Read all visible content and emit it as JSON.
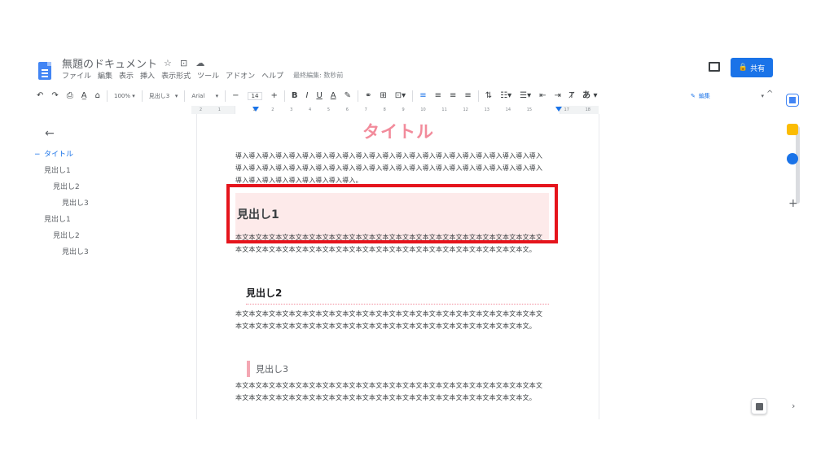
{
  "header": {
    "doc_title": "無題のドキュメント",
    "title_icons": [
      "☆",
      "⊡",
      "☁"
    ],
    "menus": [
      "ファイル",
      "編集",
      "表示",
      "挿入",
      "表示形式",
      "ツール",
      "アドオン",
      "ヘルプ"
    ],
    "last_edit": "最終編集: 数秒前",
    "share_label": "共有",
    "share_icon": "lock-icon"
  },
  "toolbar": {
    "undo": "↶",
    "redo": "↷",
    "print": "⎙",
    "spell": "A̲",
    "paint": "⌂",
    "zoom": "100%",
    "zoom_caret": "▾",
    "style": "見出し3",
    "style_caret": "▾",
    "font": "Arial",
    "font_caret": "▾",
    "minus": "−",
    "font_size": "14",
    "plus": "+",
    "bold": "B",
    "italic": "I",
    "underline": "U",
    "text_color": "A",
    "highlight": "✎",
    "link": "⚭",
    "comment": "⊞",
    "image": "⊡▾",
    "align_left": "≡",
    "align_center": "≡",
    "align_right": "≡",
    "justify": "≡",
    "line_spacing": "⇅",
    "checklist": "☷▾",
    "bullets": "☰▾",
    "indent_less": "⇤",
    "indent_more": "⇥",
    "clear_format": "Ⱦ",
    "input_tools": "あ",
    "input_caret": "▾",
    "edit_mode_label": "編集",
    "edit_mode_caret": "▾",
    "collapse": "^"
  },
  "ruler": {
    "numbers": [
      "2",
      "1",
      "",
      "1",
      "2",
      "3",
      "4",
      "5",
      "6",
      "7",
      "8",
      "9",
      "10",
      "11",
      "12",
      "13",
      "14",
      "15",
      "",
      "17",
      "18"
    ]
  },
  "outline": {
    "back": "←",
    "items": [
      {
        "label": "タイトル",
        "level": 0
      },
      {
        "label": "見出し1",
        "level": 1
      },
      {
        "label": "見出し2",
        "level": 2
      },
      {
        "label": "見出し3",
        "level": 3
      },
      {
        "label": "見出し1",
        "level": 1
      },
      {
        "label": "見出し2",
        "level": 2
      },
      {
        "label": "見出し3",
        "level": 3
      }
    ]
  },
  "document": {
    "title": "タイトル",
    "intro": "導入導入導入導入導入導入導入導入導入導入導入導入導入導入導入導入導入導入導入導入導入導入導入導入導入導入導入導入導入導入導入導入導入導入導入導入導入導入導入導入導入導入導入導入導入導入導入導入導入導入導入導入導入導入導入。",
    "h1": "見出し1",
    "body1": "本文本文本文本文本文本文本文本文本文本文本文本文本文本文本文本文本文本文本文本文本文本文本文本文本文本文本文本文本文本文本文本文本文本文本文本文本文本文本文本文本文本文本文本文本文。",
    "h2": "見出し2",
    "body2": "本文本文本文本文本文本文本文本文本文本文本文本文本文本文本文本文本文本文本文本文本文本文本文本文本文本文本文本文本文本文本文本文本文本文本文本文本文本文本文本文本文本文本文本文本文。",
    "h3": "見出し3",
    "body3": "本文本文本文本文本文本文本文本文本文本文本文本文本文本文本文本文本文本文本文本文本文本文本文本文本文本文本文本文本文本文本文本文本文本文本文本文本文本文本文本文本文本文本文本文本文。"
  },
  "side_panel": {
    "plus": "+",
    "expand": "›"
  },
  "colors": {
    "accent": "#1a73e8",
    "title_pink": "#f28b9b",
    "highlight_frame": "#e5141c"
  }
}
